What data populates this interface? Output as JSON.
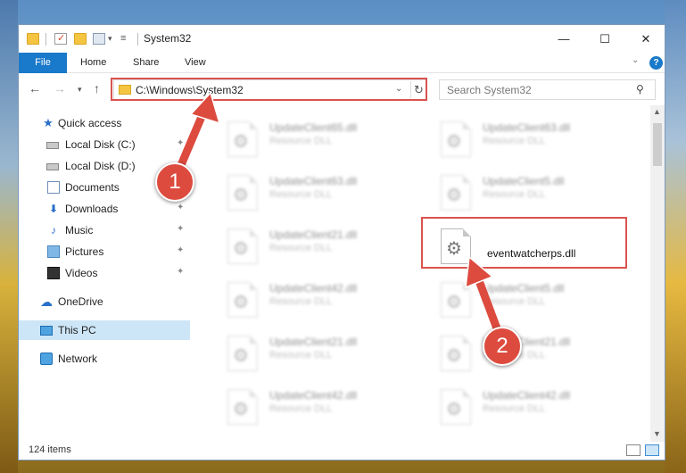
{
  "window": {
    "title": "System32",
    "controls": {
      "minimize": "—",
      "maximize": "☐",
      "close": "✕"
    }
  },
  "ribbon": {
    "tabs": [
      {
        "label": "File"
      },
      {
        "label": "Home"
      },
      {
        "label": "Share"
      },
      {
        "label": "View"
      }
    ],
    "help": "?"
  },
  "navigation": {
    "address": "C:\\Windows\\System32",
    "search_placeholder": "Search System32"
  },
  "sidebar": {
    "items": [
      {
        "label": "Quick access",
        "icon": "star-icon"
      },
      {
        "label": "Local Disk (C:)",
        "icon": "disk-icon",
        "pinned": true
      },
      {
        "label": "Local Disk (D:)",
        "icon": "disk-icon",
        "pinned": false
      },
      {
        "label": "Documents",
        "icon": "documents-icon",
        "pinned": true
      },
      {
        "label": "Downloads",
        "icon": "download-icon",
        "pinned": true
      },
      {
        "label": "Music",
        "icon": "music-icon",
        "pinned": true
      },
      {
        "label": "Pictures",
        "icon": "pictures-icon",
        "pinned": true
      },
      {
        "label": "Videos",
        "icon": "videos-icon",
        "pinned": true
      },
      {
        "label": "OneDrive",
        "icon": "cloud-icon"
      },
      {
        "label": "This PC",
        "icon": "computer-icon",
        "selected": true
      },
      {
        "label": "Network",
        "icon": "network-icon"
      }
    ]
  },
  "files": [
    {
      "name": "UpdateClient65.dll",
      "type": "Resource DLL"
    },
    {
      "name": "UpdateClient63.dll",
      "type": "Resource DLL"
    },
    {
      "name": "UpdateClient63.dll",
      "type": "Resource DLL"
    },
    {
      "name": "UpdateClient5.dll",
      "type": "Resource DLL"
    },
    {
      "name": "UpdateClient21.dll",
      "type": "Resource DLL"
    },
    {
      "name": "eventwatcherps.dll",
      "type": "",
      "highlighted": true
    },
    {
      "name": "UpdateClient42.dll",
      "type": "Resource DLL"
    },
    {
      "name": "UpdateClient5.dll",
      "type": "Resource DLL"
    },
    {
      "name": "UpdateClient21.dll",
      "type": "Resource DLL"
    },
    {
      "name": "UpdateClient21.dll",
      "type": "Resource DLL"
    },
    {
      "name": "UpdateClient42.dll",
      "type": "Resource DLL"
    },
    {
      "name": "UpdateClient42.dll",
      "type": "Resource DLL"
    }
  ],
  "status": {
    "item_count": "124 items"
  },
  "annotations": {
    "step1": "1",
    "step2": "2",
    "color": "#dd4b3f"
  }
}
